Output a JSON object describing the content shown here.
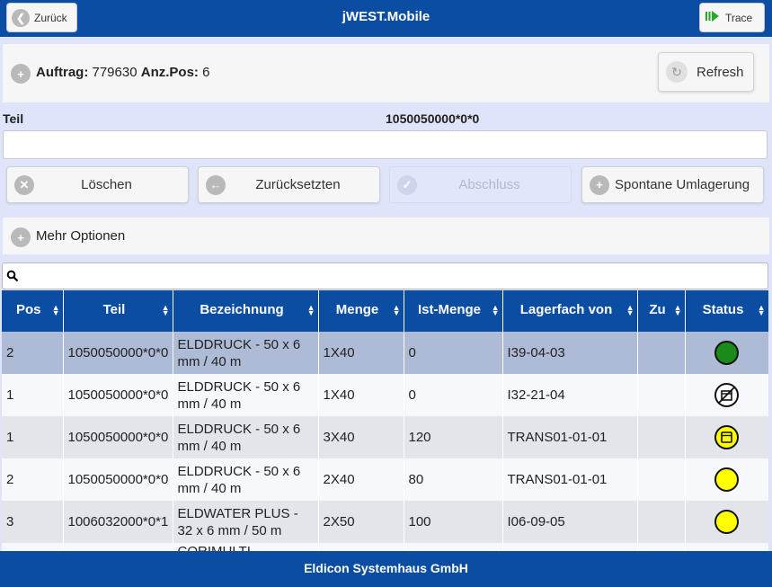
{
  "header": {
    "title": "jWEST.Mobile",
    "back_label": "Zurück",
    "trace_label": "Trace"
  },
  "auftrag": {
    "label": "Auftrag:",
    "value": "779630",
    "pos_label": "Anz.Pos:",
    "pos_value": "6",
    "refresh_label": "Refresh"
  },
  "teil": {
    "label": "Teil",
    "value": "1050050000*0*0",
    "input_value": ""
  },
  "actions": {
    "loeschen": "Löschen",
    "zuruecksetzen": "Zurücksetzten",
    "abschluss": "Abschluss",
    "spontan": "Spontane Umlagerung"
  },
  "mehr_optionen": "Mehr Optionen",
  "search": {
    "value": ""
  },
  "table": {
    "columns": [
      "Pos",
      "Teil",
      "Bezeichnung",
      "Menge",
      "Ist-Menge",
      "Lagerfach von",
      "Zu",
      "Status"
    ],
    "rows": [
      {
        "pos": "2",
        "teil": "1050050000*0*0",
        "bez": "ELDDRUCK - 50 x 6 mm / 40 m",
        "menge": "1X40",
        "ist": "0",
        "von": "I39-04-03",
        "zu": "",
        "status": "green-circle"
      },
      {
        "pos": "1",
        "teil": "1050050000*0*0",
        "bez": "ELDDRUCK - 50 x 6 mm / 40 m",
        "menge": "1X40",
        "ist": "0",
        "von": "I32-21-04",
        "zu": "",
        "status": "blocked-circle"
      },
      {
        "pos": "1",
        "teil": "1050050000*0*0",
        "bez": "ELDDRUCK - 50 x 6 mm / 40 m",
        "menge": "3X40",
        "ist": "120",
        "von": "TRANS01-01-01",
        "zu": "",
        "status": "yellow-box-circle"
      },
      {
        "pos": "2",
        "teil": "1050050000*0*0",
        "bez": "ELDDRUCK - 50 x 6 mm / 40 m",
        "menge": "2X40",
        "ist": "80",
        "von": "TRANS01-01-01",
        "zu": "",
        "status": "yellow-circle"
      },
      {
        "pos": "3",
        "teil": "1006032000*0*1",
        "bez": "ELDWATER PLUS - 32 x 6 mm / 50 m",
        "menge": "2X50",
        "ist": "100",
        "von": "I06-09-05",
        "zu": "",
        "status": "yellow-circle"
      },
      {
        "pos": "",
        "teil": "",
        "bez": "CORIMULTI",
        "menge": "",
        "ist": "",
        "von": "",
        "zu": "",
        "status": ""
      }
    ]
  },
  "colors": {
    "brand": "#0a4da3",
    "green": "#1a8a1a",
    "yellow": "#ffff00"
  },
  "footer": "Eldicon Systemhaus GmbH"
}
